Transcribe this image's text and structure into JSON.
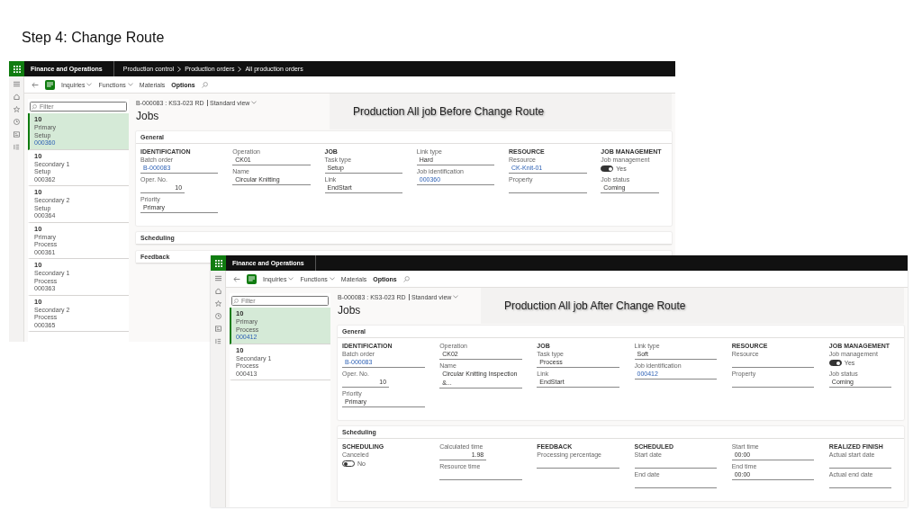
{
  "slide_title": "Step 4: Change Route",
  "windows": [
    {
      "brand": "Finance and Operations",
      "breadcrumb": [
        "Production control",
        "Production orders",
        "All production orders"
      ],
      "toolbar": [
        {
          "label": "Inquiries",
          "dropdown": true,
          "selected": false
        },
        {
          "label": "Functions",
          "dropdown": true,
          "selected": false
        },
        {
          "label": "Materials",
          "dropdown": false,
          "selected": false
        },
        {
          "label": "Options",
          "dropdown": false,
          "selected": true
        }
      ],
      "filter": {
        "placeholder": "Filter"
      },
      "jobs": [
        {
          "number": "10",
          "priority": "Primary",
          "task": "Setup",
          "id": "000360",
          "selected": true
        },
        {
          "number": "10",
          "priority": "Secondary 1",
          "task": "Setup",
          "id": "000362",
          "selected": false
        },
        {
          "number": "10",
          "priority": "Secondary 2",
          "task": "Setup",
          "id": "000364",
          "selected": false
        },
        {
          "number": "10",
          "priority": "Primary",
          "task": "Process",
          "id": "000361",
          "selected": false
        },
        {
          "number": "10",
          "priority": "Secondary 1",
          "task": "Process",
          "id": "000363",
          "selected": false
        },
        {
          "number": "10",
          "priority": "Secondary 2",
          "task": "Process",
          "id": "000365",
          "selected": false
        }
      ],
      "record": "B-000083 : KS3-023 RD",
      "view": "Standard view",
      "page_title": "Jobs",
      "annotation": "Production All job Before Change Route",
      "sections": [
        {
          "title": "General",
          "columns": [
            {
              "heading": "IDENTIFICATION",
              "fields": [
                {
                  "label": "Batch order",
                  "kind": "link",
                  "value": "B-000083"
                },
                {
                  "label": "Oper. No.",
                  "kind": "number",
                  "value": "10"
                },
                {
                  "label": "Priority",
                  "kind": "text",
                  "value": "Primary"
                }
              ]
            },
            {
              "fields": [
                {
                  "label": "Operation",
                  "kind": "text",
                  "value": "CK01"
                },
                {
                  "label": "Name",
                  "kind": "text",
                  "value": "Circular Knitting"
                }
              ]
            },
            {
              "heading": "JOB",
              "fields": [
                {
                  "label": "Task type",
                  "kind": "text",
                  "value": "Setup"
                },
                {
                  "label": "Link",
                  "kind": "text",
                  "value": "EndStart"
                }
              ]
            },
            {
              "fields": [
                {
                  "label": "Link type",
                  "kind": "text",
                  "value": "Hard"
                },
                {
                  "label": "Job identification",
                  "kind": "link",
                  "value": "000360"
                }
              ]
            },
            {
              "heading": "RESOURCE",
              "fields": [
                {
                  "label": "Resource",
                  "kind": "link",
                  "value": "CK-Knit-01"
                },
                {
                  "label": "Property",
                  "kind": "text"
                }
              ]
            },
            {
              "heading": "JOB MANAGEMENT",
              "fields": [
                {
                  "label": "Job management",
                  "kind": "toggle",
                  "on": true,
                  "value": "Yes"
                },
                {
                  "label": "Job status",
                  "kind": "text",
                  "value": "Coming"
                }
              ]
            }
          ]
        },
        {
          "title": "Scheduling"
        },
        {
          "title": "Feedback"
        }
      ]
    },
    {
      "brand": "Finance and Operations",
      "toolbar": [
        {
          "label": "Inquiries",
          "dropdown": true,
          "selected": false
        },
        {
          "label": "Functions",
          "dropdown": true,
          "selected": false
        },
        {
          "label": "Materials",
          "dropdown": false,
          "selected": false
        },
        {
          "label": "Options",
          "dropdown": false,
          "selected": true
        }
      ],
      "filter": {
        "placeholder": "Filter"
      },
      "jobs": [
        {
          "number": "10",
          "priority": "Primary",
          "task": "Process",
          "id": "000412",
          "selected": true
        },
        {
          "number": "10",
          "priority": "Secondary 1",
          "task": "Process",
          "id": "000413",
          "selected": false
        }
      ],
      "record": "B-000083 : KS3-023 RD",
      "view": "Standard view",
      "page_title": "Jobs",
      "annotation": "Production All job After Change Route",
      "sections": [
        {
          "title": "General",
          "columns": [
            {
              "heading": "IDENTIFICATION",
              "fields": [
                {
                  "label": "Batch order",
                  "kind": "link",
                  "value": "B-000083"
                },
                {
                  "label": "Oper. No.",
                  "kind": "number",
                  "value": "10"
                },
                {
                  "label": "Priority",
                  "kind": "text",
                  "value": "Primary"
                }
              ]
            },
            {
              "fields": [
                {
                  "label": "Operation",
                  "kind": "text",
                  "value": "CK02"
                },
                {
                  "label": "Name",
                  "kind": "text",
                  "value": "Circular Knitting Inspection &..."
                }
              ]
            },
            {
              "heading": "JOB",
              "fields": [
                {
                  "label": "Task type",
                  "kind": "text",
                  "value": "Process"
                },
                {
                  "label": "Link",
                  "kind": "text",
                  "value": "EndStart"
                }
              ]
            },
            {
              "fields": [
                {
                  "label": "Link type",
                  "kind": "text",
                  "value": "Soft"
                },
                {
                  "label": "Job identification",
                  "kind": "link",
                  "value": "000412"
                }
              ]
            },
            {
              "heading": "RESOURCE",
              "fields": [
                {
                  "label": "Resource",
                  "kind": "text"
                },
                {
                  "label": "Property",
                  "kind": "text"
                }
              ]
            },
            {
              "heading": "JOB MANAGEMENT",
              "fields": [
                {
                  "label": "Job management",
                  "kind": "toggle",
                  "on": true,
                  "value": "Yes"
                },
                {
                  "label": "Job status",
                  "kind": "text",
                  "value": "Coming"
                }
              ]
            }
          ]
        },
        {
          "title": "Scheduling",
          "columns": [
            {
              "heading": "SCHEDULING",
              "fields": [
                {
                  "label": "Canceled",
                  "kind": "toggle",
                  "on": false,
                  "value": "No"
                }
              ]
            },
            {
              "fields": [
                {
                  "label": "Calculated time",
                  "kind": "number",
                  "value": "1.98"
                },
                {
                  "label": "Resource time",
                  "kind": "text"
                }
              ]
            },
            {
              "heading": "FEEDBACK",
              "fields": [
                {
                  "label": "Processing percentage",
                  "kind": "text"
                }
              ]
            },
            {
              "heading": "SCHEDULED",
              "fields": [
                {
                  "label": "Start date",
                  "kind": "text"
                },
                {
                  "label": "End date",
                  "kind": "text"
                }
              ]
            },
            {
              "fields": [
                {
                  "label": "Start time",
                  "kind": "text",
                  "value": "00:00"
                },
                {
                  "label": "End time",
                  "kind": "text",
                  "value": "00:00"
                }
              ]
            },
            {
              "heading": "REALIZED FINISH",
              "fields": [
                {
                  "label": "Actual start date",
                  "kind": "text"
                },
                {
                  "label": "Actual end date",
                  "kind": "text"
                }
              ]
            }
          ]
        }
      ]
    }
  ]
}
